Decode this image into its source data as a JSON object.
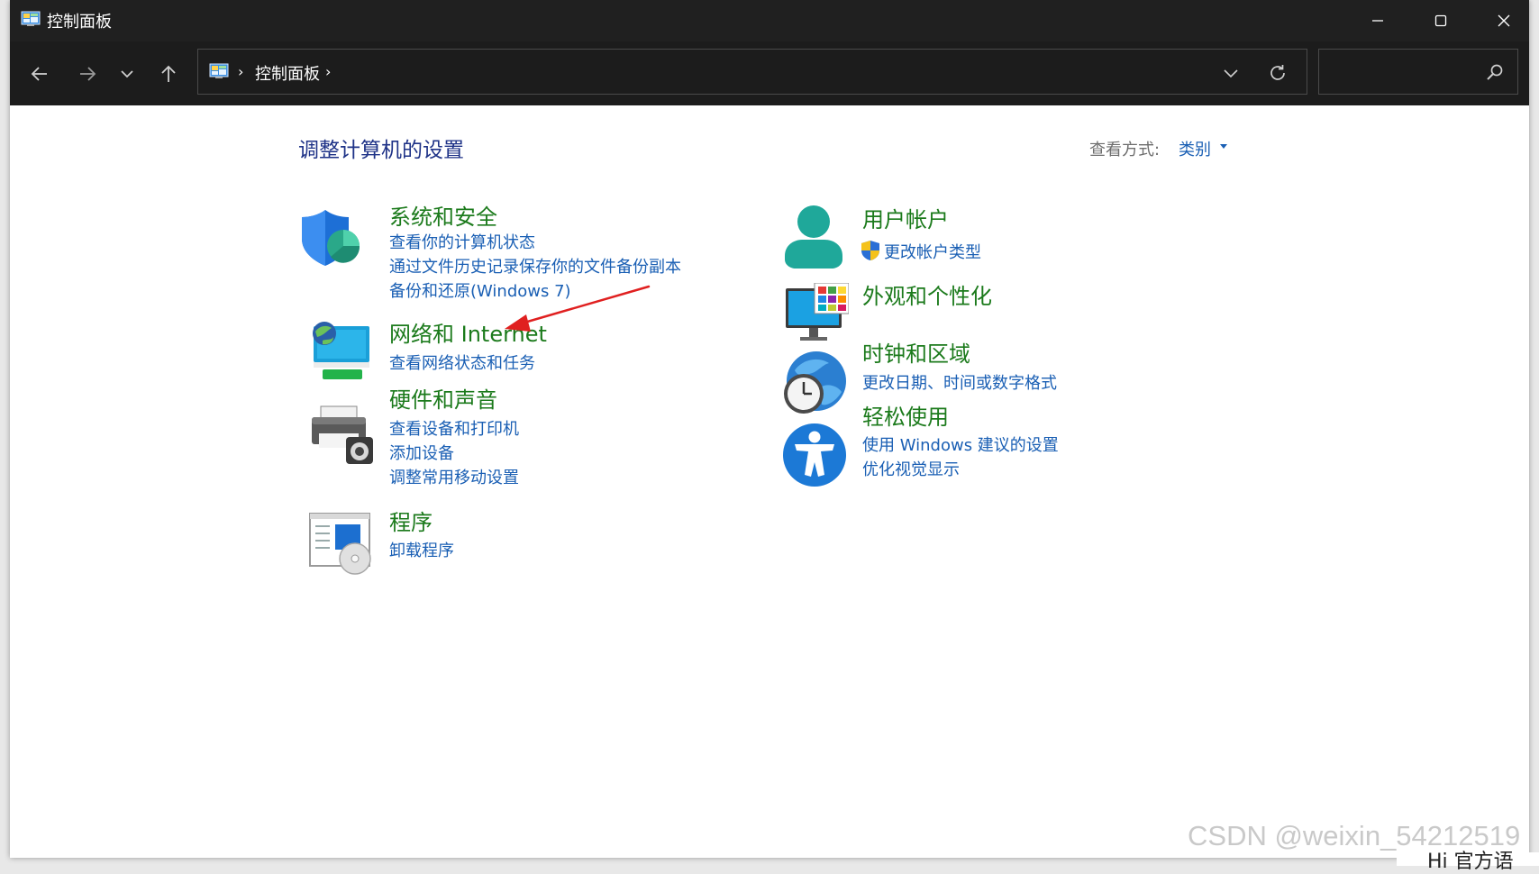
{
  "window": {
    "title": "控制面板",
    "controls": {
      "minimize": "minimize",
      "maximize": "maximize",
      "close": "close"
    }
  },
  "nav": {
    "breadcrumb": "控制面板",
    "separator": "›",
    "search_placeholder": ""
  },
  "main": {
    "title": "调整计算机的设置",
    "view_by_label": "查看方式:",
    "view_by_value": "类别"
  },
  "categories": {
    "system_security": {
      "title": "系统和安全",
      "links": [
        "查看你的计算机状态",
        "通过文件历史记录保存你的文件备份副本",
        "备份和还原(Windows 7)"
      ]
    },
    "network_internet": {
      "title": "网络和 Internet",
      "links": [
        "查看网络状态和任务"
      ]
    },
    "hardware_sound": {
      "title": "硬件和声音",
      "links": [
        "查看设备和打印机",
        "添加设备",
        "调整常用移动设置"
      ]
    },
    "programs": {
      "title": "程序",
      "links": [
        "卸载程序"
      ]
    },
    "user_accounts": {
      "title": "用户帐户",
      "links": [
        "更改帐户类型"
      ]
    },
    "appearance": {
      "title": "外观和个性化",
      "links": []
    },
    "clock_region": {
      "title": "时钟和区域",
      "links": [
        "更改日期、时间或数字格式"
      ]
    },
    "ease_of_access": {
      "title": "轻松使用",
      "links": [
        "使用 Windows 建议的设置",
        "优化视觉显示"
      ]
    }
  },
  "watermark": "CSDN @weixin_54212519",
  "bottom_snippet": "Hi 官方语",
  "colors": {
    "category_title": "#1b7a1b",
    "link": "#1a5fb4",
    "page_title": "#1e3287",
    "titlebar": "#202020",
    "annotation_arrow": "#e02020"
  }
}
